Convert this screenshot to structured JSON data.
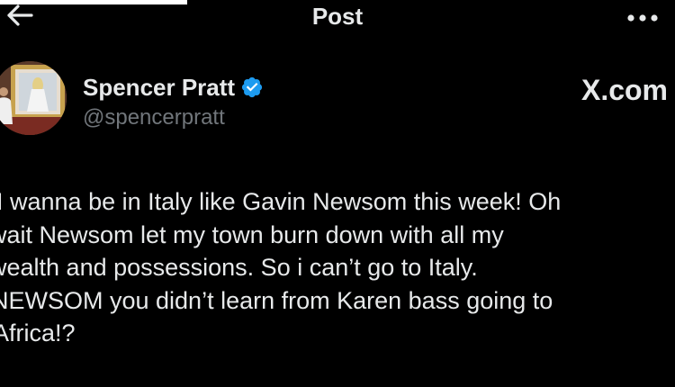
{
  "header": {
    "title": "Post",
    "back_icon": "arrow-left-icon",
    "more_icon": "more-horizontal-icon"
  },
  "author": {
    "display_name": "Spencer Pratt",
    "handle": "@spencerpratt",
    "verified_icon": "verified-badge-icon",
    "verified_color": "#1d9bf0"
  },
  "source": {
    "label": "X.com"
  },
  "tweet": {
    "lines": [
      "I wanna be in Italy like Gavin Newsom this week! Oh",
      "wait Newsom let my town burn down with all my",
      "wealth and possessions.  So i can’t go to Italy.",
      "NEWSOM you didn’t learn from Karen bass going to",
      "Africa!?"
    ]
  },
  "colors": {
    "background": "#000000",
    "text_primary": "#e7e9ea",
    "text_secondary": "#71767b"
  }
}
